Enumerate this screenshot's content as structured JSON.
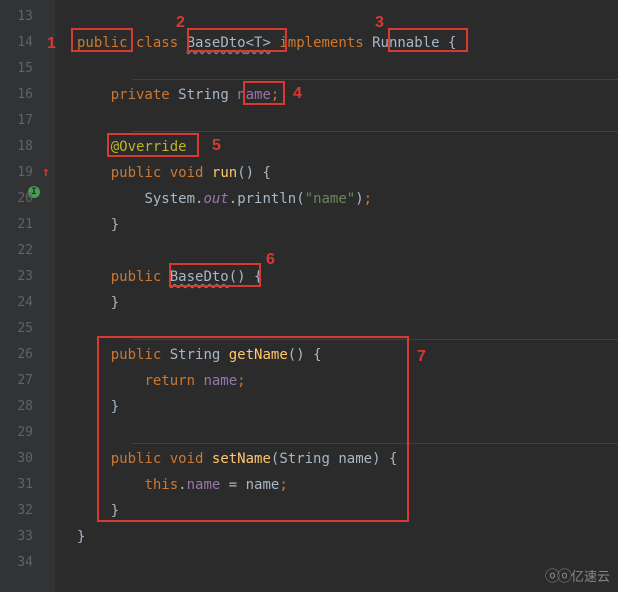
{
  "gutter": {
    "start": 13,
    "end": 34
  },
  "code": {
    "l14": {
      "public": "public",
      "class": "class",
      "name": "BaseDto",
      "generic": "<T>",
      "implements": "implements",
      "iface": "Runnable",
      "brace": "{"
    },
    "l16": {
      "private": "private",
      "type": "String",
      "field": "name",
      "semi": ";"
    },
    "l18": {
      "annotation": "@Override"
    },
    "l19": {
      "public": "public",
      "void": "void",
      "method": "run",
      "parens": "()",
      "brace": "{"
    },
    "l20": {
      "sys": "System.",
      "out": "out",
      "dot": ".",
      "println": "println",
      "open": "(",
      "str": "\"name\"",
      "close": ")",
      "semi": ";"
    },
    "l21": {
      "brace": "}"
    },
    "l23": {
      "public": "public",
      "ctor": "BaseDto",
      "parens": "()",
      "brace": "{"
    },
    "l24": {
      "brace": "}"
    },
    "l26": {
      "public": "public",
      "type": "String",
      "method": "getName",
      "parens": "()",
      "brace": "{"
    },
    "l27": {
      "return": "return",
      "field": "name",
      "semi": ";"
    },
    "l28": {
      "brace": "}"
    },
    "l30": {
      "public": "public",
      "void": "void",
      "method": "setName",
      "open": "(",
      "ptype": "String",
      "pname": "name",
      "close": ")",
      "brace": "{"
    },
    "l31": {
      "this": "this",
      "dot": ".",
      "field": "name",
      "eq": " = ",
      "param": "name",
      "semi": ";"
    },
    "l32": {
      "brace": "}"
    },
    "l33": {
      "brace": "}"
    }
  },
  "annotations": {
    "a1": "1",
    "a2": "2",
    "a3": "3",
    "a4": "4",
    "a5": "5",
    "a6": "6",
    "a7": "7"
  },
  "icons": {
    "impl": "I",
    "arrow": "↑"
  },
  "watermark": "亿速云"
}
